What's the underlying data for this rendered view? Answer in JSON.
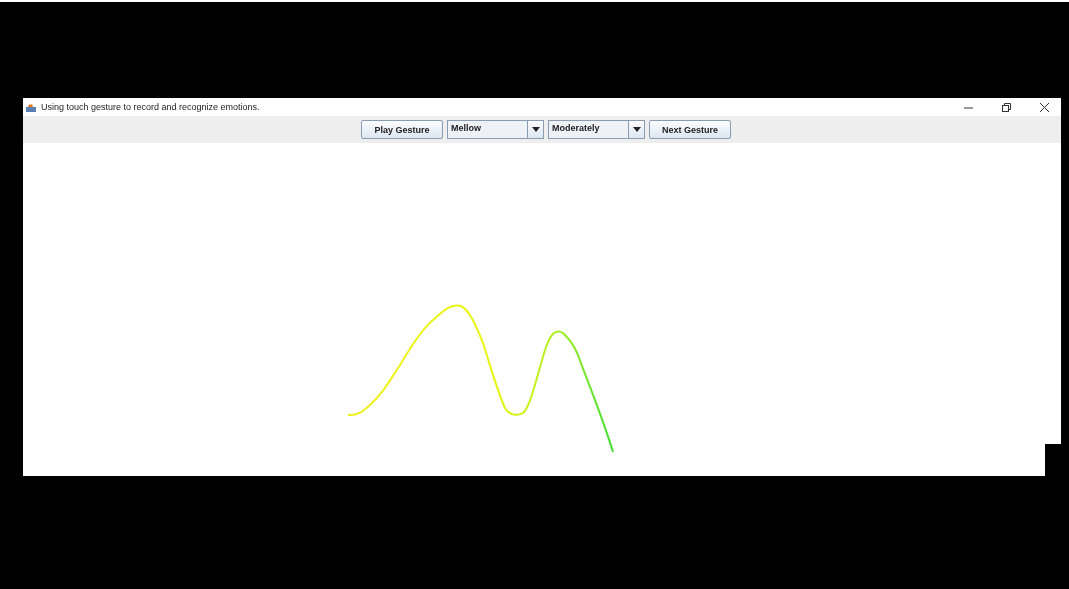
{
  "window": {
    "title": "Using touch gesture to record and recognize emotions."
  },
  "toolbar": {
    "play_button": "Play Gesture",
    "emotion_select": {
      "value": "Mellow"
    },
    "intensity_select": {
      "value": "Moderately"
    },
    "next_button": "Next Gesture"
  }
}
